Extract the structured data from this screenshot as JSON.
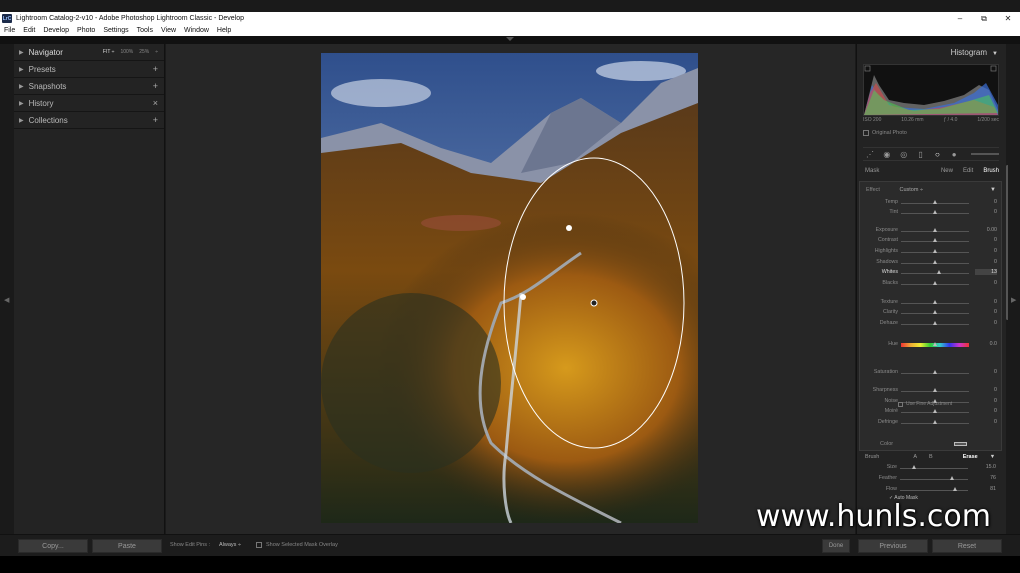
{
  "window": {
    "logo_text": "LrC",
    "title": "Lightroom Catalog-2-v10 - Adobe Photoshop Lightroom Classic - Develop",
    "controls": [
      "–",
      "⧉",
      "✕"
    ]
  },
  "menu": [
    "File",
    "Edit",
    "Develop",
    "Photo",
    "Settings",
    "Tools",
    "View",
    "Window",
    "Help"
  ],
  "left_panel": {
    "navigator": {
      "label": "Navigator",
      "zoom_options": [
        "FIT ÷",
        "100%",
        "25%",
        "÷"
      ]
    },
    "items": [
      {
        "label": "Presets",
        "action": "+"
      },
      {
        "label": "Snapshots",
        "action": "+"
      },
      {
        "label": "History",
        "action": "×"
      },
      {
        "label": "Collections",
        "action": "+"
      }
    ]
  },
  "right_panel": {
    "histogram_title": "Histogram",
    "histogram_info": [
      "ISO 200",
      "10.26 mm",
      "ƒ / 4.0",
      "1/200 sec"
    ],
    "original_photo_label": "Original Photo",
    "mask": {
      "label": "Mask",
      "options": [
        "New",
        "Edit",
        "Brush"
      ],
      "active": "Brush"
    },
    "effect": {
      "label": "Effect",
      "value": "Custom ÷"
    },
    "sliders": [
      {
        "label": "Temp",
        "value": "0",
        "pos": 0.5
      },
      {
        "label": "Tint",
        "value": "0",
        "pos": 0.5
      },
      {
        "label": "Exposure",
        "value": "0.00",
        "pos": 0.5
      },
      {
        "label": "Contrast",
        "value": "0",
        "pos": 0.5
      },
      {
        "label": "Highlights",
        "value": "0",
        "pos": 0.5
      },
      {
        "label": "Shadows",
        "value": "0",
        "pos": 0.5
      },
      {
        "label": "Whites",
        "value": "13",
        "pos": 0.56
      },
      {
        "label": "Blacks",
        "value": "0",
        "pos": 0.5
      },
      {
        "label": "Texture",
        "value": "0",
        "pos": 0.5
      },
      {
        "label": "Clarity",
        "value": "0",
        "pos": 0.5
      },
      {
        "label": "Dehaze",
        "value": "0",
        "pos": 0.5
      },
      {
        "label": "Hue",
        "value": "0.0",
        "pos": 0.5
      },
      {
        "label": "Saturation",
        "value": "0",
        "pos": 0.5
      },
      {
        "label": "Sharpness",
        "value": "0",
        "pos": 0.5
      },
      {
        "label": "Noise",
        "value": "0",
        "pos": 0.5
      },
      {
        "label": "Moiré",
        "value": "0",
        "pos": 0.5
      },
      {
        "label": "Defringe",
        "value": "0",
        "pos": 0.5
      }
    ],
    "fine_adjustment_label": "Use Fine Adjustment",
    "color_label": "Color",
    "brush": {
      "label": "Brush",
      "a": "A",
      "b": "B",
      "erase": "Erase"
    },
    "brush_sliders": [
      {
        "label": "Size",
        "value": "15.0",
        "pos": 0.2
      },
      {
        "label": "Feather",
        "value": "76",
        "pos": 0.76
      },
      {
        "label": "Flow",
        "value": "81",
        "pos": 0.81
      }
    ],
    "auto_mask_label": "✓ Auto Mask"
  },
  "bottom": {
    "copy": "Copy...",
    "paste": "Paste",
    "show_edit_pins": "Show Edit Pins :",
    "edit_pins_value": "Always ÷",
    "show_mask_overlay": "Show Selected Mask Overlay",
    "done": "Done",
    "previous": "Previous",
    "reset": "Reset"
  },
  "watermark": "www.hunls.com",
  "colors": {
    "panel": "#232323",
    "background": "#1a1a1a",
    "accent_text": "#ffffff"
  }
}
